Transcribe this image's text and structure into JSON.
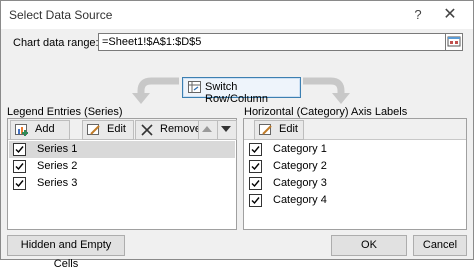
{
  "window": {
    "title": "Select Data Source",
    "help": "?",
    "close": "✕"
  },
  "range": {
    "label": "Chart data range:",
    "value": "=Sheet1!$A$1:$D$5"
  },
  "switch_button": "Switch Row/Column",
  "legend": {
    "title": "Legend Entries (Series)",
    "add": "Add",
    "edit": "Edit",
    "remove": "Remove",
    "items": [
      {
        "label": "Series 1",
        "checked": true,
        "selected": true
      },
      {
        "label": "Series 2",
        "checked": true,
        "selected": false
      },
      {
        "label": "Series 3",
        "checked": true,
        "selected": false
      }
    ]
  },
  "axis": {
    "title": "Horizontal (Category) Axis Labels",
    "edit": "Edit",
    "items": [
      {
        "label": "Category 1",
        "checked": true
      },
      {
        "label": "Category 2",
        "checked": true
      },
      {
        "label": "Category 3",
        "checked": true
      },
      {
        "label": "Category 4",
        "checked": true
      }
    ]
  },
  "footer": {
    "hidden_empty": "Hidden and Empty Cells",
    "ok": "OK",
    "cancel": "Cancel"
  }
}
